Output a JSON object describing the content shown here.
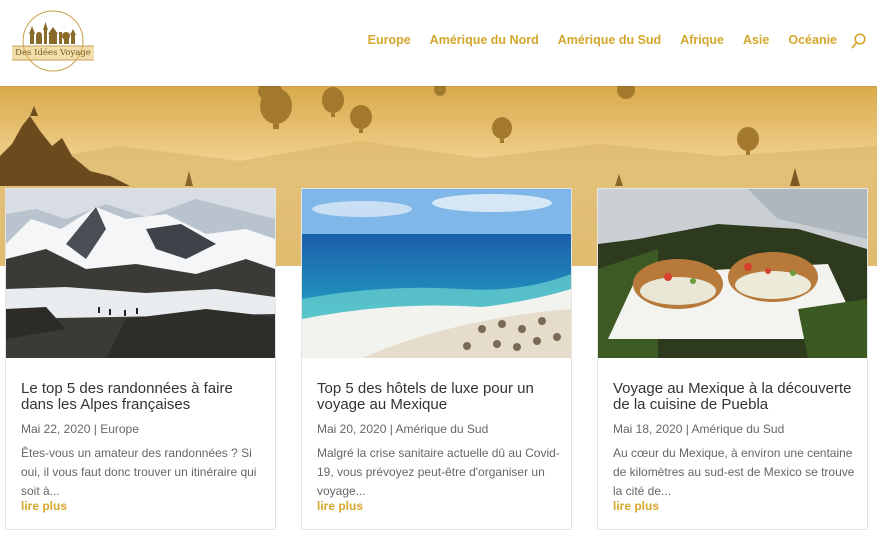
{
  "brand": {
    "name": "Des Idées Voyage",
    "accent": "#d4a72c"
  },
  "nav": {
    "items": [
      "Europe",
      "Amérique du Nord",
      "Amérique du Sud",
      "Afrique",
      "Asie",
      "Océanie"
    ]
  },
  "search": {
    "icon": "search-icon"
  },
  "hero": {
    "image": "hot-air-balloons-at-sunrise"
  },
  "posts": [
    {
      "title": "Le top 5 des randonnées à faire dans les Alpes françaises",
      "date": "Mai 22, 2020",
      "category": "Europe",
      "excerpt": "Êtes-vous un amateur des randonnées ? Si oui, il vous faut donc trouver un itinéraire qui soit à...",
      "more": "lire plus"
    },
    {
      "title": "Top 5 des hôtels de luxe pour un voyage au Mexique",
      "date": "Mai 20, 2020",
      "category": "Amérique du Sud",
      "excerpt": "Malgré la crise sanitaire actuelle dû au Covid-19, vous prévoyez peut-être d'organiser un voyage...",
      "more": "lire plus"
    },
    {
      "title": "Voyage au Mexique à la découverte de la cuisine de Puebla",
      "date": "Mai 18, 2020",
      "category": "Amérique du Sud",
      "excerpt": "Au cœur du Mexique, à environ une centaine de kilomètres au sud-est de Mexico se trouve la cité de...",
      "more": "lire plus"
    }
  ]
}
